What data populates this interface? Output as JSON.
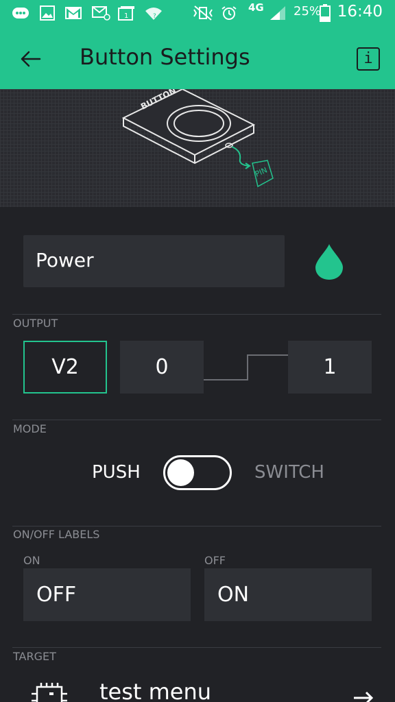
{
  "status_bar": {
    "network": "4G",
    "battery_percent": "25%",
    "time": "16:40"
  },
  "header": {
    "title": "Button Settings",
    "info_label": "i"
  },
  "illustration": {
    "device_label": "BUTTON",
    "pin_label": "PIN"
  },
  "widget": {
    "name": "Power",
    "color": "#23c48e"
  },
  "output": {
    "section_label": "OUTPUT",
    "pin": "V2",
    "min": "0",
    "max": "1"
  },
  "mode": {
    "section_label": "MODE",
    "push_label": "PUSH",
    "switch_label": "SWITCH",
    "selected": "PUSH"
  },
  "labels": {
    "section_label": "ON/OFF LABELS",
    "on_label": "ON",
    "on_value": "OFF",
    "off_label": "OFF",
    "off_value": "ON"
  },
  "target": {
    "section_label": "TARGET",
    "name": "test menu"
  },
  "colors": {
    "accent": "#23c48e",
    "background": "#212226",
    "field": "#2e3035"
  }
}
